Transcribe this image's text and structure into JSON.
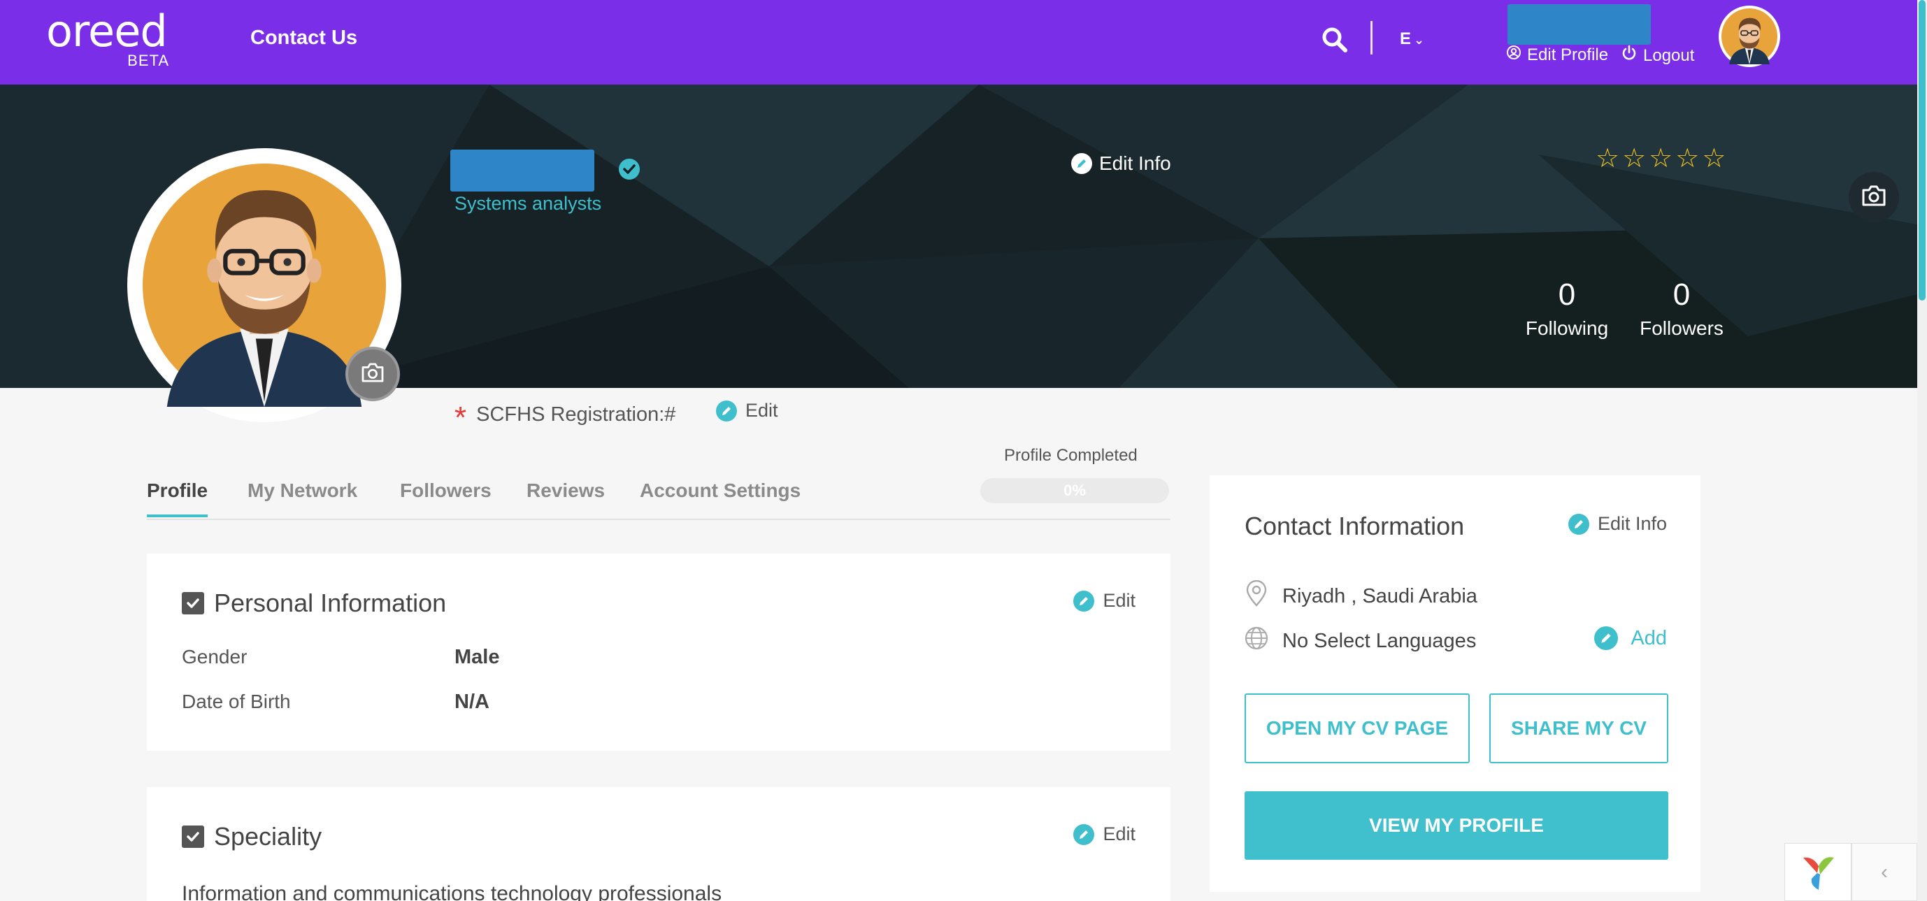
{
  "nav": {
    "logo_text": "oreed",
    "logo_sub": "BETA",
    "contact_label": "Contact Us",
    "lang_label": "E",
    "edit_profile_label": "Edit Profile",
    "logout_label": "Logout"
  },
  "profile": {
    "job_title": "Systems analysts",
    "edit_info_label": "Edit Info",
    "rating": 0,
    "following_count": "0",
    "following_label": "Following",
    "followers_count": "0",
    "followers_label": "Followers",
    "scfhs_label": "SCFHS Registration:#",
    "scfhs_edit_label": "Edit"
  },
  "tabs": [
    {
      "label": "Profile",
      "active": true
    },
    {
      "label": "My Network",
      "active": false
    },
    {
      "label": "Followers",
      "active": false
    },
    {
      "label": "Reviews",
      "active": false
    },
    {
      "label": "Account Settings",
      "active": false
    }
  ],
  "completion": {
    "label": "Profile Completed",
    "percent_text": "0%",
    "percent": 0
  },
  "personal": {
    "title": "Personal Information",
    "edit_label": "Edit",
    "gender_label": "Gender",
    "gender_value": "Male",
    "dob_label": "Date of Birth",
    "dob_value": "N/A"
  },
  "speciality": {
    "title": "Speciality",
    "edit_label": "Edit",
    "text": "Information and communications technology professionals"
  },
  "contact": {
    "title": "Contact Information",
    "edit_label": "Edit Info",
    "location": "Riyadh , Saudi Arabia",
    "languages": "No Select Languages",
    "add_label": "Add",
    "open_cv_label": "OPEN MY CV PAGE",
    "share_cv_label": "SHARE MY CV",
    "view_profile_label": "VIEW MY PROFILE"
  },
  "colors": {
    "nav_purple": "#7a2ee8",
    "accent_teal": "#3fbfcc",
    "cover_dark": "#172227",
    "star_gold": "#f3c623",
    "name_blue": "#2e86c8"
  }
}
